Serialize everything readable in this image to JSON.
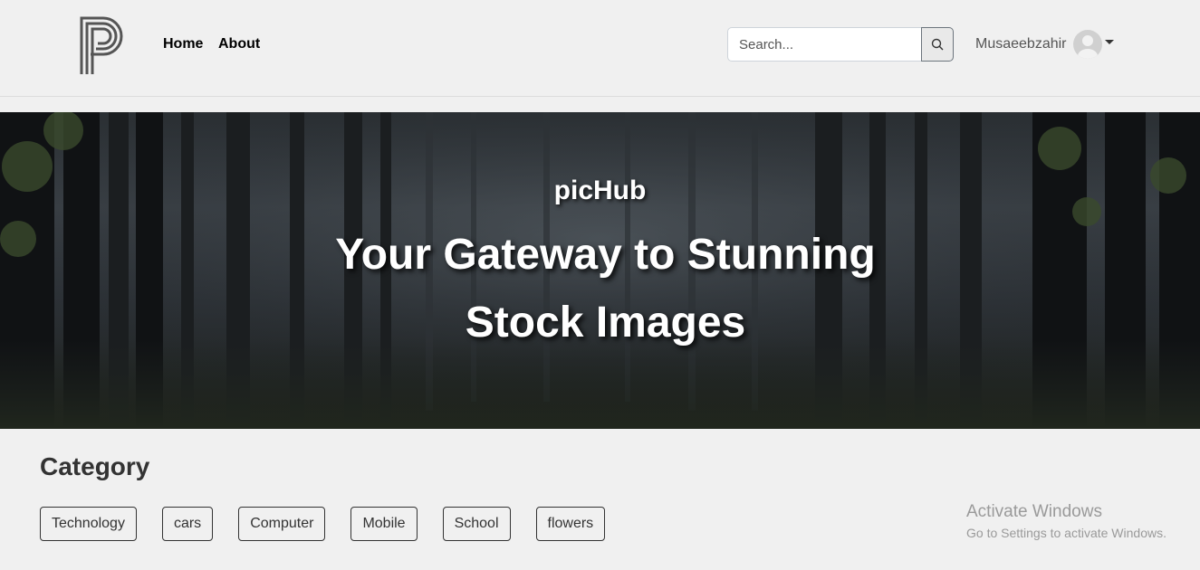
{
  "nav": {
    "logo_name": "pichub-logo",
    "links": [
      {
        "label": "Home"
      },
      {
        "label": "About"
      }
    ],
    "search": {
      "placeholder": "Search...",
      "value": ""
    },
    "user": {
      "name": "Musaeebzahir"
    }
  },
  "hero": {
    "subtitle": "picHub",
    "title": "Your Gateway to Stunning Stock Images"
  },
  "category": {
    "heading": "Category",
    "items": [
      "Technology",
      "cars",
      "Computer",
      "Mobile",
      "School",
      "flowers"
    ]
  },
  "watermark": {
    "title": "Activate Windows",
    "subtitle": "Go to Settings to activate Windows."
  },
  "colors": {
    "background": "#f0f0f0",
    "text_dark": "#333333",
    "hero_text": "#ffffff"
  }
}
